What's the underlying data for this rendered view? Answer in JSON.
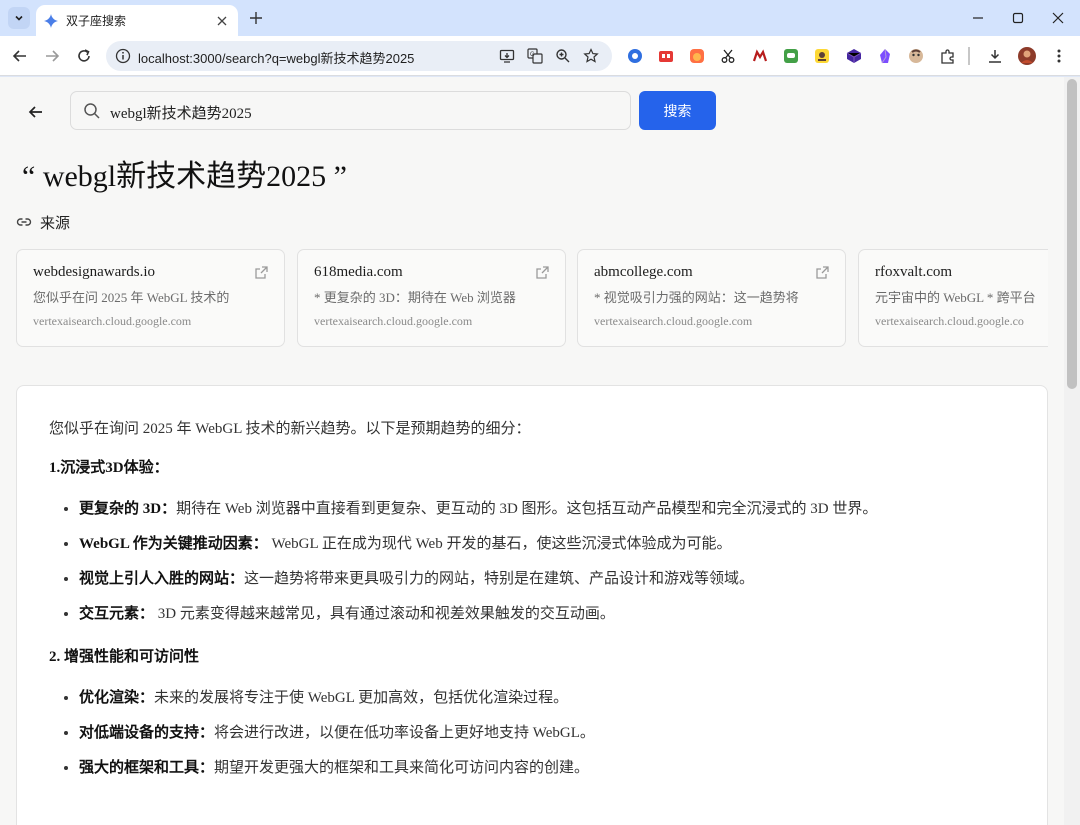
{
  "browser": {
    "tab_title": "双子座搜索",
    "url": "localhost:3000/search?q=webgl新技术趋势2025"
  },
  "search": {
    "query": "webgl新技术趋势2025",
    "button_label": "搜索"
  },
  "heading": {
    "open_quote": "“",
    "query": "webgl新技术趋势2025",
    "close_quote": "”"
  },
  "sources": {
    "label": "来源",
    "cards": [
      {
        "title": "webdesignawards.io",
        "snippet": "您似乎在问 2025 年 WebGL 技术的",
        "domain": "vertexaisearch.cloud.google.com"
      },
      {
        "title": "618media.com",
        "snippet": "* 更复杂的 3D：期待在 Web 浏览器",
        "domain": "vertexaisearch.cloud.google.com"
      },
      {
        "title": "abmcollege.com",
        "snippet": "* 视觉吸引力强的网站：这一趋势将",
        "domain": "vertexaisearch.cloud.google.com"
      },
      {
        "title": "rfoxvalt.com",
        "snippet": "元宇宙中的 WebGL * 跨平台",
        "domain": "vertexaisearch.cloud.google.co"
      }
    ]
  },
  "answer": {
    "intro": "您似乎在询问 2025 年 WebGL 技术的新兴趋势。以下是预期趋势的细分：",
    "section1": {
      "title": "1.沉浸式3D体验：",
      "items": [
        {
          "term": "更复杂的 3D：",
          "text": "期待在 Web 浏览器中直接看到更复杂、更互动的 3D 图形。这包括互动产品模型和完全沉浸式的 3D 世界。"
        },
        {
          "term": "WebGL 作为关键推动因素：",
          "text": " WebGL 正在成为现代 Web 开发的基石，使这些沉浸式体验成为可能。"
        },
        {
          "term": "视觉上引人入胜的网站：",
          "text": "这一趋势将带来更具吸引力的网站，特别是在建筑、产品设计和游戏等领域。"
        },
        {
          "term": "交互元素：",
          "text": " 3D 元素变得越来越常见，具有通过滚动和视差效果触发的交互动画。"
        }
      ]
    },
    "section2": {
      "title": "2. 增强性能和可访问性",
      "items": [
        {
          "term": "优化渲染：",
          "text": "未来的发展将专注于使 WebGL 更加高效，包括优化渲染过程。"
        },
        {
          "term": "对低端设备的支持：",
          "text": "将会进行改进，以便在低功率设备上更好地支持 WebGL。"
        },
        {
          "term": "强大的框架和工具：",
          "text": "期望开发更强大的框架和工具来简化可访问内容的创建。"
        }
      ]
    }
  }
}
